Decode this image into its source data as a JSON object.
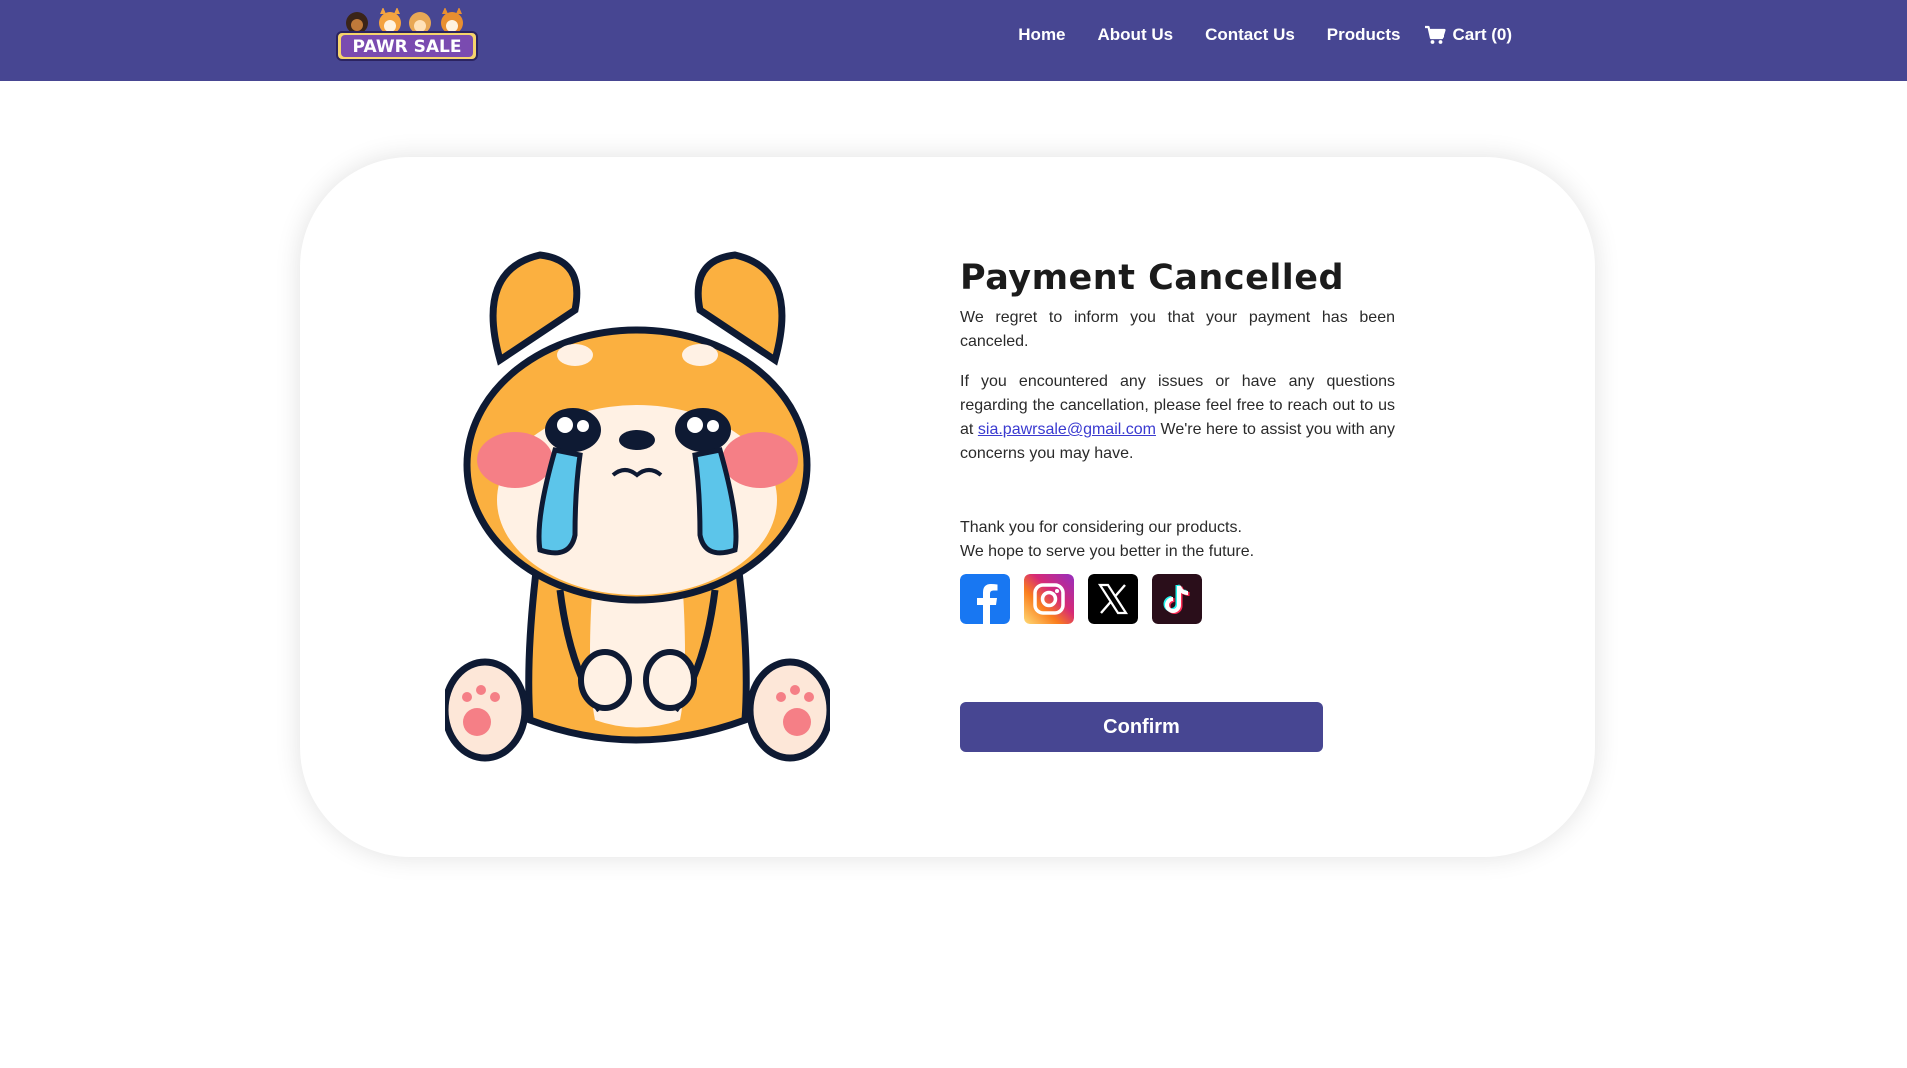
{
  "brand": {
    "logo_text": "PAWR SALE"
  },
  "nav": {
    "links": [
      "Home",
      "About Us",
      "Contact Us",
      "Products"
    ],
    "cart_label": "Cart (0)"
  },
  "main": {
    "title": "Payment Cancelled",
    "paragraph1": "We regret to inform you that your payment has been canceled.",
    "paragraph2_before": "If you encountered any issues or have any questions regarding the cancellation, please feel free to reach out to us at ",
    "email": "sia.pawrsale@gmail.com",
    "paragraph2_after": " We're here to assist you with any concerns you may have.",
    "thanks_line1": "Thank you for considering our products.",
    "thanks_line2": "We hope to serve you better in the future.",
    "confirm_label": "Confirm"
  },
  "socials": [
    {
      "name": "facebook-icon",
      "color": "#1877f2"
    },
    {
      "name": "instagram-icon",
      "color": "#e1306c"
    },
    {
      "name": "x-icon",
      "color": "#000000"
    },
    {
      "name": "tiktok-icon",
      "color": "#111111"
    }
  ],
  "colors": {
    "brand": "#474692",
    "link": "#3a3ad0"
  }
}
